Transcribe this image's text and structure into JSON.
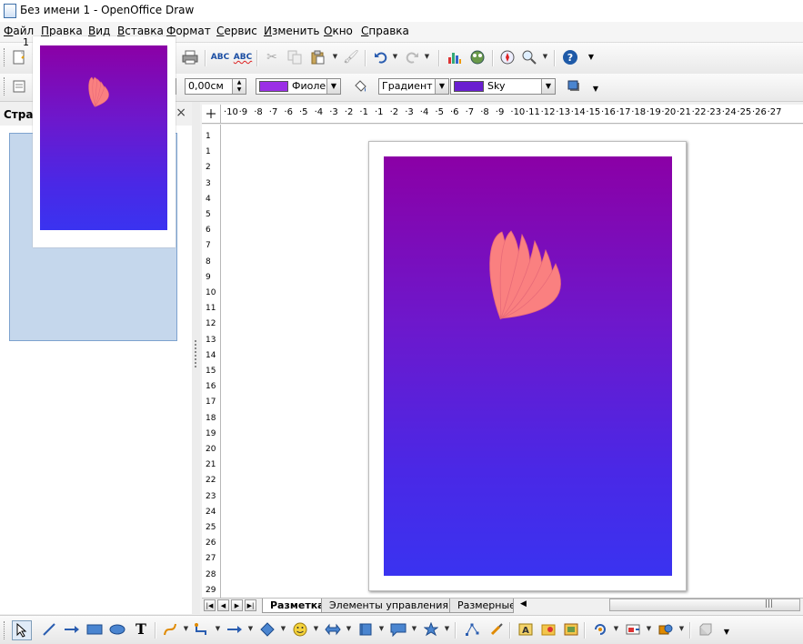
{
  "window": {
    "title": "Без имени 1 - OpenOffice Draw"
  },
  "menu": [
    "Файл",
    "Правка",
    "Вид",
    "Вставка",
    "Формат",
    "Сервис",
    "Изменить",
    "Окно",
    "Справка"
  ],
  "line_toolbar": {
    "line_width": "0,00см",
    "area_color_name": "Фиоле",
    "area_color": "#9b2fe6",
    "fill_style": "Градиент",
    "gradient_name": "Sky",
    "gradient_swatch": "#6a1fd0"
  },
  "side_pane": {
    "title": "Страницы",
    "close": "×",
    "page_number": "1"
  },
  "ruler": {
    "horizontal": [
      "10",
      "9",
      "8",
      "7",
      "6",
      "5",
      "4",
      "3",
      "2",
      "1",
      "1",
      "2",
      "3",
      "4",
      "5",
      "6",
      "7",
      "8",
      "9",
      "10",
      "11",
      "12",
      "13",
      "14",
      "15",
      "16",
      "17",
      "18",
      "19",
      "20",
      "21",
      "22",
      "23",
      "24",
      "25",
      "26",
      "27"
    ],
    "vertical": [
      "1",
      "1",
      "2",
      "3",
      "4",
      "5",
      "6",
      "7",
      "8",
      "9",
      "10",
      "11",
      "12",
      "13",
      "14",
      "15",
      "16",
      "17",
      "18",
      "19",
      "20",
      "21",
      "22",
      "23",
      "24",
      "25",
      "26",
      "27",
      "28",
      "29"
    ]
  },
  "tabs": [
    "Разметка",
    "Элементы управления",
    "Размерные"
  ],
  "colors": {
    "gradient_top": "#8b00a6",
    "gradient_bottom": "#3a33f0",
    "flower": "#fa8080"
  },
  "icons": {
    "standard": [
      "new-icon",
      "open-icon",
      "save-icon",
      "email-icon",
      "edit-file-icon",
      "export-pdf-icon",
      "print-icon",
      "spellcheck-icon",
      "autospell-icon",
      "cut-icon",
      "copy-icon",
      "paste-icon",
      "format-paintbrush-icon",
      "undo-icon",
      "redo-icon",
      "chart-icon",
      "gallery-icon",
      "navigator-icon",
      "zoom-icon",
      "help-icon"
    ],
    "drawing": [
      "select-icon",
      "line-icon",
      "arrow-line-icon",
      "rectangle-icon",
      "ellipse-icon",
      "text-icon",
      "curve-icon",
      "connector-icon",
      "lines-arrows-icon",
      "basic-shapes-icon",
      "symbol-shapes-icon",
      "block-arrows-icon",
      "flowchart-icon",
      "callouts-icon",
      "stars-icon",
      "points-icon",
      "glue-points-icon",
      "fontwork-icon",
      "from-file-icon",
      "gallery-icon",
      "rotate-icon",
      "align-icon",
      "arrange-icon",
      "extrusion-icon"
    ]
  }
}
